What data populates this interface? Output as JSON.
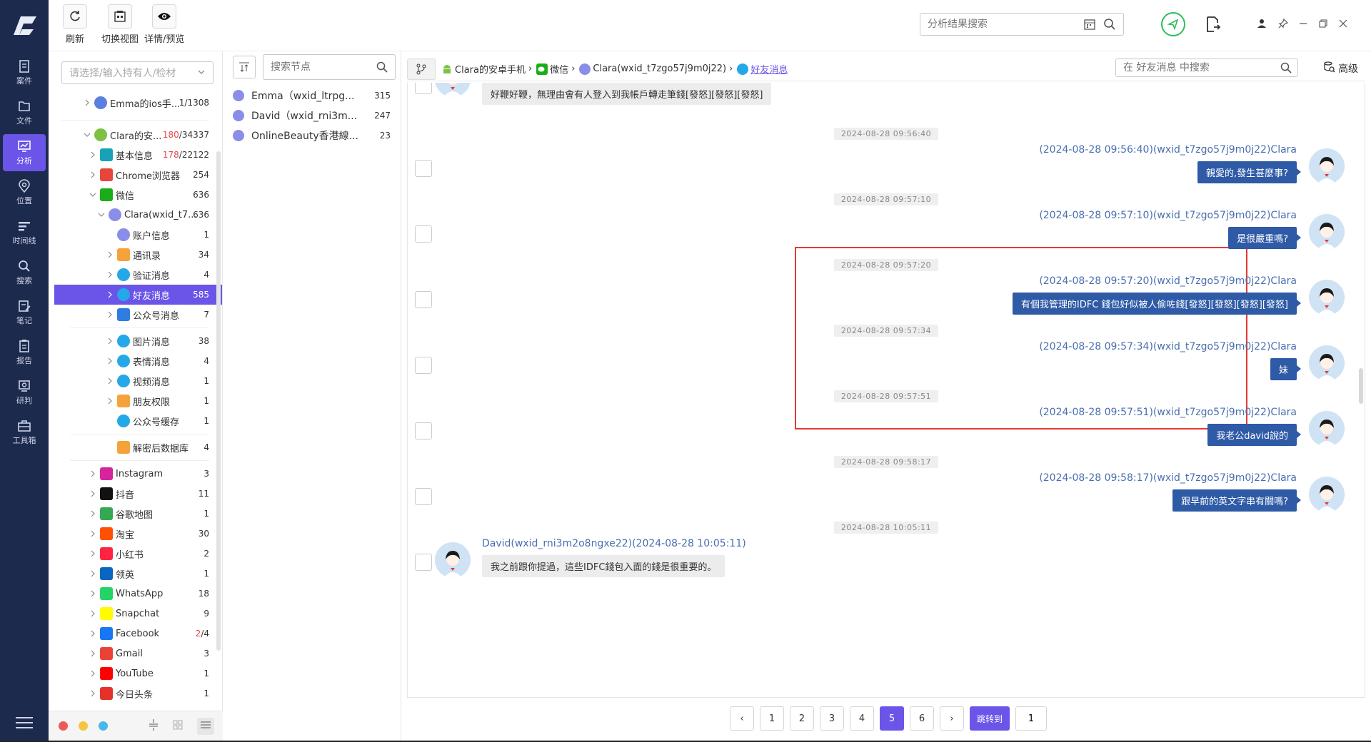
{
  "toolbar": {
    "refresh_label": "刷新",
    "switch_view_label": "切换视图",
    "details_label": "详情/预览",
    "search_placeholder": "分析结果搜索"
  },
  "rail": {
    "items": [
      {
        "label": "案件",
        "icon": "case-icon"
      },
      {
        "label": "文件",
        "icon": "folder-icon"
      },
      {
        "label": "分析",
        "icon": "analysis-icon",
        "active": true
      },
      {
        "label": "位置",
        "icon": "location-icon"
      },
      {
        "label": "时间线",
        "icon": "timeline-icon"
      },
      {
        "label": "搜索",
        "icon": "search-icon"
      },
      {
        "label": "笔记",
        "icon": "note-icon"
      },
      {
        "label": "报告",
        "icon": "report-icon"
      },
      {
        "label": "研判",
        "icon": "judge-icon"
      },
      {
        "label": "工具箱",
        "icon": "toolbox-icon"
      }
    ]
  },
  "tree": {
    "owner_placeholder": "请选择/输入持有人/检材",
    "nodes": [
      {
        "label": "Emma的ios手...",
        "count": "1/1308",
        "level": 0,
        "arrow": ">",
        "icon": "ios-icon",
        "color": "#5b7fe0"
      },
      {
        "label": "Clara的安...",
        "count_red": "180",
        "count": "/34337",
        "level": 0,
        "arrow": "v",
        "icon": "android-icon",
        "color": "#7cc142"
      },
      {
        "label": "基本信息",
        "count_red": "178",
        "count": "/22122",
        "level": 1,
        "arrow": ">",
        "icon": "info-icon",
        "color": "#17a2b8"
      },
      {
        "label": "Chrome浏览器",
        "count": "254",
        "level": 1,
        "arrow": ">",
        "icon": "chrome-icon",
        "color": "#e8453c"
      },
      {
        "label": "微信",
        "count": "636",
        "level": 1,
        "arrow": "v",
        "icon": "wechat-icon",
        "color": "#1aad19"
      },
      {
        "label": "Clara(wxid_t7...",
        "count": "636",
        "level": 2,
        "arrow": "v",
        "icon": "user-icon",
        "color": "#8a8ee8"
      },
      {
        "label": "账户信息",
        "count": "1",
        "level": 3,
        "arrow": "",
        "icon": "account-icon",
        "color": "#8a8ee8"
      },
      {
        "label": "通讯录",
        "count": "34",
        "level": 3,
        "arrow": ">",
        "icon": "contacts-icon",
        "color": "#f6a23b"
      },
      {
        "label": "验证消息",
        "count": "4",
        "level": 3,
        "arrow": ">",
        "icon": "chat-bubble-icon",
        "color": "#25a8e8"
      },
      {
        "label": "好友消息",
        "count": "585",
        "level": 3,
        "arrow": ">",
        "icon": "chat-bubble-icon",
        "color": "#25a8e8",
        "selected": true
      },
      {
        "label": "公众号消息",
        "count": "7",
        "level": 3,
        "arrow": ">",
        "icon": "official-account-icon",
        "color": "#2f7de1"
      },
      {
        "label": "图片消息",
        "count": "38",
        "level": 3,
        "arrow": ">",
        "icon": "chat-bubble-icon",
        "color": "#25a8e8"
      },
      {
        "label": "表情消息",
        "count": "4",
        "level": 3,
        "arrow": ">",
        "icon": "chat-bubble-icon",
        "color": "#25a8e8"
      },
      {
        "label": "视频消息",
        "count": "1",
        "level": 3,
        "arrow": ">",
        "icon": "chat-bubble-icon",
        "color": "#25a8e8"
      },
      {
        "label": "朋友权限",
        "count": "1",
        "level": 3,
        "arrow": ">",
        "icon": "contacts-icon",
        "color": "#f6a23b"
      },
      {
        "label": "公众号缓存",
        "count": "1",
        "level": 3,
        "arrow": "",
        "icon": "chat-bubble-icon",
        "color": "#25a8e8"
      },
      {
        "label": "解密后数据库",
        "count": "4",
        "level": 3,
        "arrow": "",
        "icon": "database-icon",
        "color": "#f6a23b"
      },
      {
        "label": "Instagram",
        "count": "3",
        "level": 1,
        "arrow": ">",
        "icon": "instagram-icon",
        "color": "#d6249f"
      },
      {
        "label": "抖音",
        "count": "11",
        "level": 1,
        "arrow": ">",
        "icon": "tiktok-icon",
        "color": "#111111"
      },
      {
        "label": "谷歌地图",
        "count": "1",
        "level": 1,
        "arrow": ">",
        "icon": "google-maps-icon",
        "color": "#34a853"
      },
      {
        "label": "淘宝",
        "count": "30",
        "level": 1,
        "arrow": ">",
        "icon": "taobao-icon",
        "color": "#ff5000"
      },
      {
        "label": "小红书",
        "count": "2",
        "level": 1,
        "arrow": ">",
        "icon": "xiaohongshu-icon",
        "color": "#ff2442"
      },
      {
        "label": "领英",
        "count": "1",
        "level": 1,
        "arrow": ">",
        "icon": "linkedin-icon",
        "color": "#0a66c2"
      },
      {
        "label": "WhatsApp",
        "count": "18",
        "level": 1,
        "arrow": ">",
        "icon": "whatsapp-icon",
        "color": "#25d366"
      },
      {
        "label": "Snapchat",
        "count": "9",
        "level": 1,
        "arrow": ">",
        "icon": "snapchat-icon",
        "color": "#fffc00"
      },
      {
        "label": "Facebook",
        "count_red": "2",
        "count": "/4",
        "level": 1,
        "arrow": ">",
        "icon": "facebook-icon",
        "color": "#1877f2"
      },
      {
        "label": "Gmail",
        "count": "3",
        "level": 1,
        "arrow": ">",
        "icon": "gmail-icon",
        "color": "#ea4335"
      },
      {
        "label": "YouTube",
        "count": "1",
        "level": 1,
        "arrow": ">",
        "icon": "youtube-icon",
        "color": "#ff0000"
      },
      {
        "label": "今日头条",
        "count": "1",
        "level": 1,
        "arrow": ">",
        "icon": "toutiao-icon",
        "color": "#e5312b"
      }
    ]
  },
  "node_panel": {
    "search_placeholder": "搜索节点",
    "items": [
      {
        "label": "Emma（wxid_ltrpg...",
        "count": "315"
      },
      {
        "label": "David（wxid_rni3m...",
        "count": "247"
      },
      {
        "label": "OnlineBeauty香港線...",
        "count": "23"
      }
    ]
  },
  "breadcrumb": {
    "items": [
      "Clara的安卓手机",
      "微信",
      "Clara(wxid_t7zgo57j9m0j22)",
      "好友消息"
    ],
    "search_placeholder": "在 好友消息 中搜索",
    "advanced_label": "高级"
  },
  "messages": [
    {
      "side": "left",
      "text": "好鞭好鞭，無理由會有人登入到我帳戶轉走筆錢[發怒][發怒][發怒]"
    },
    {
      "side": "right",
      "time": "2024-08-28 09:56:40",
      "sender": "(2024-08-28 09:56:40)(wxid_t7zgo57j9m0j22)Clara",
      "text": "親愛的,發生甚麼事?"
    },
    {
      "side": "right",
      "time": "2024-08-28 09:57:10",
      "sender": "(2024-08-28 09:57:10)(wxid_t7zgo57j9m0j22)Clara",
      "text": "是很嚴重嗎?"
    },
    {
      "side": "right",
      "time": "2024-08-28 09:57:20",
      "sender": "(2024-08-28 09:57:20)(wxid_t7zgo57j9m0j22)Clara",
      "text": "有個我管理的IDFC 錢包好似被人偷咗錢[發怒][發怒][發怒][發怒]"
    },
    {
      "side": "right",
      "time": "2024-08-28 09:57:34",
      "sender": "(2024-08-28 09:57:34)(wxid_t7zgo57j9m0j22)Clara",
      "text": "妹"
    },
    {
      "side": "right",
      "time": "2024-08-28 09:57:51",
      "sender": "(2024-08-28 09:57:51)(wxid_t7zgo57j9m0j22)Clara",
      "text": "我老公david說的"
    },
    {
      "side": "right",
      "time": "2024-08-28 09:58:17",
      "sender": "(2024-08-28 09:58:17)(wxid_t7zgo57j9m0j22)Clara",
      "text": "跟早前的英文字串有關嗎?"
    },
    {
      "side": "left",
      "time": "2024-08-28 10:05:11",
      "sender": "David(wxid_rni3m2o8ngxe22)(2024-08-28 10:05:11)",
      "text": "我之前跟你提過，這些IDFC錢包入面的錢是很重要的。"
    }
  ],
  "pager": {
    "pages": [
      "1",
      "2",
      "3",
      "4",
      "5",
      "6"
    ],
    "current": "5",
    "jump_label": "跳转到",
    "jump_value": "1"
  },
  "colors": {
    "rail_bg": "#1c2a4e",
    "accent": "#6a55e8",
    "bubble_right": "#2e5aa6",
    "highlight_box": "#e53935"
  }
}
